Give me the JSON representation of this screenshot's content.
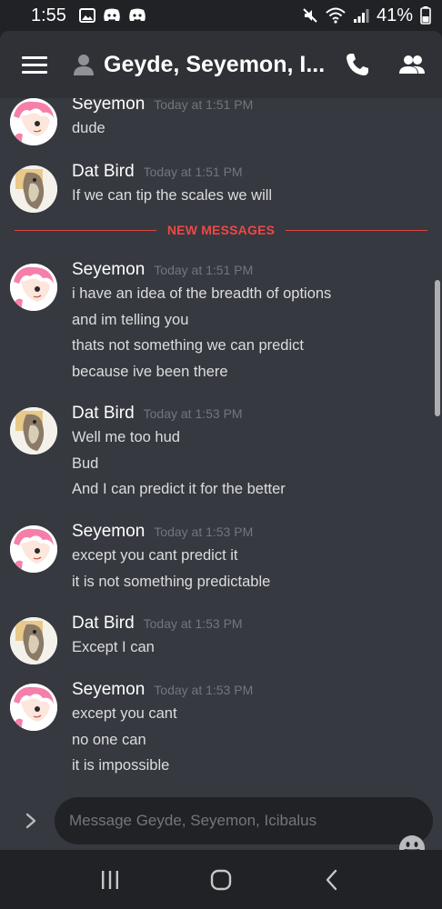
{
  "status_bar": {
    "time": "1:55",
    "battery_percent": "41%",
    "icons_left": [
      "image-notification-icon",
      "discord-notification-icon",
      "discord-notification-icon"
    ],
    "icons_right": [
      "mute-icon",
      "wifi-icon",
      "signal-icon",
      "battery-icon"
    ]
  },
  "header": {
    "title": "Geyde, Seyemon, I...",
    "icons": [
      "hamburger-icon",
      "group-dm-icon",
      "phone-icon",
      "members-icon"
    ]
  },
  "messages": [
    {
      "author": "Seyemon",
      "timestamp": "Today at 1:51 PM",
      "avatar": "seyemon-avatar",
      "lines": [
        "dude"
      ]
    },
    {
      "author": "Dat Bird",
      "timestamp": "Today at 1:51 PM",
      "avatar": "dat-bird-avatar",
      "lines": [
        "If we can tip the scales we will"
      ]
    },
    {
      "author": "Seyemon",
      "timestamp": "Today at 1:51 PM",
      "avatar": "seyemon-avatar",
      "lines": [
        "i have an idea of the breadth of options",
        "and im telling you",
        "thats not something we can predict",
        "because ive been there"
      ]
    },
    {
      "author": "Dat Bird",
      "timestamp": "Today at 1:53 PM",
      "avatar": "dat-bird-avatar",
      "lines": [
        "Well me too hud",
        "Bud",
        "And I can predict it for the better"
      ]
    },
    {
      "author": "Seyemon",
      "timestamp": "Today at 1:53 PM",
      "avatar": "seyemon-avatar",
      "lines": [
        "except you cant predict it",
        "it is not something predictable"
      ]
    },
    {
      "author": "Dat Bird",
      "timestamp": "Today at 1:53 PM",
      "avatar": "dat-bird-avatar",
      "lines": [
        "Except I can"
      ]
    },
    {
      "author": "Seyemon",
      "timestamp": "Today at 1:53 PM",
      "avatar": "seyemon-avatar",
      "lines": [
        "except you cant",
        "no one can",
        "it is impossible"
      ]
    }
  ],
  "divider": {
    "label": "NEW MESSAGES"
  },
  "composer": {
    "placeholder": "Message Geyde, Seyemon, Icibalus",
    "value": ""
  },
  "nav_bar": {
    "icons": [
      "recent-apps-icon",
      "home-icon",
      "back-icon"
    ]
  },
  "colors": {
    "background": "#36393f",
    "header": "#2f3136",
    "new_messages": "#f04747",
    "timestamp": "#72767d"
  }
}
